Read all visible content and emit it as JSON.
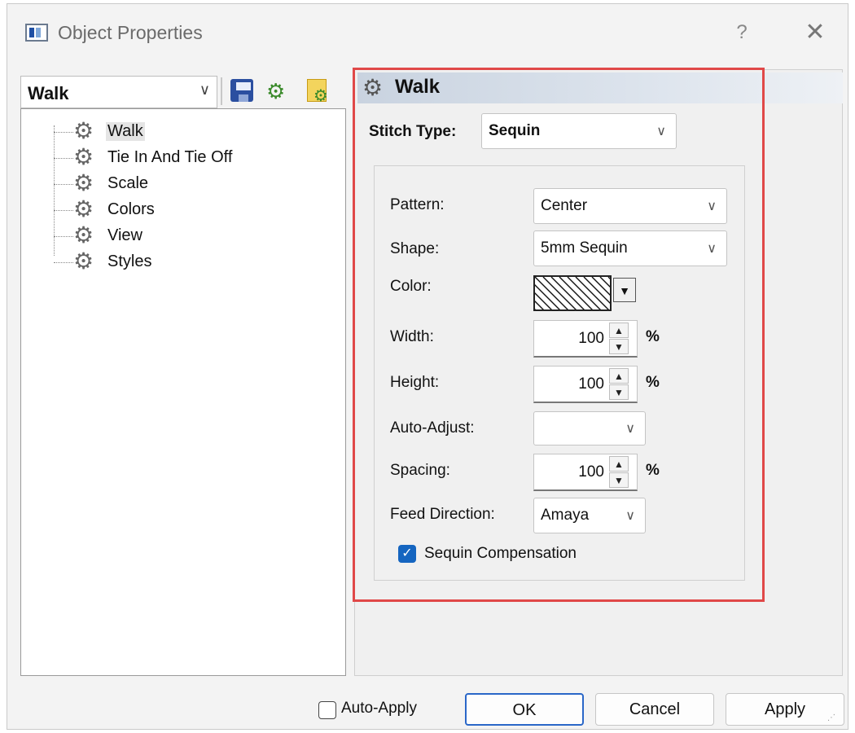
{
  "window": {
    "title": "Object Properties",
    "help_label": "?",
    "close_label": "✕"
  },
  "left_panel": {
    "combo_value": "Walk",
    "tree": [
      {
        "label": "Walk",
        "selected": true
      },
      {
        "label": "Tie In And Tie Off",
        "selected": false
      },
      {
        "label": "Scale",
        "selected": false
      },
      {
        "label": "Colors",
        "selected": false
      },
      {
        "label": "View",
        "selected": false
      },
      {
        "label": "Styles",
        "selected": false
      }
    ]
  },
  "right_panel": {
    "header_title": "Walk",
    "stitch_type_label": "Stitch Type:",
    "stitch_type_value": "Sequin",
    "fields": {
      "pattern_label": "Pattern:",
      "pattern_value": "Center",
      "shape_label": "Shape:",
      "shape_value": "5mm Sequin",
      "color_label": "Color:",
      "width_label": "Width:",
      "width_value": "100",
      "width_unit": "%",
      "height_label": "Height:",
      "height_value": "100",
      "height_unit": "%",
      "auto_adjust_label": "Auto-Adjust:",
      "auto_adjust_value": "",
      "spacing_label": "Spacing:",
      "spacing_value": "100",
      "spacing_unit": "%",
      "feed_direction_label": "Feed Direction:",
      "feed_direction_value": "Amaya",
      "sequin_compensation_label": "Sequin Compensation",
      "sequin_compensation_checked": true
    }
  },
  "footer": {
    "auto_apply_label": "Auto-Apply",
    "auto_apply_checked": false,
    "ok_label": "OK",
    "cancel_label": "Cancel",
    "apply_label": "Apply"
  },
  "colors": {
    "highlight_border": "#e04848",
    "checkbox_accent": "#1565c0",
    "default_button_border": "#2a67c8"
  }
}
